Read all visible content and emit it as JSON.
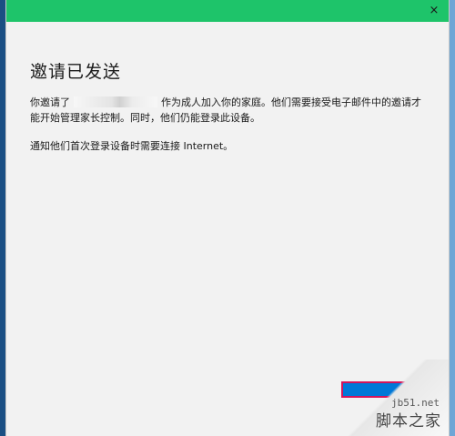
{
  "window": {
    "close_label": "×"
  },
  "dialog": {
    "heading": "邀请已发送",
    "paragraph1_before": "你邀请了",
    "paragraph1_after": "作为成人加入你的家庭。他们需要接受电子邮件中的邀请才能开始管理家长控制。同时，他们仍能登录此设备。",
    "paragraph2": "通知他们首次登录设备时需要连接 Internet。"
  },
  "watermark": {
    "url": "jb51.net",
    "name": "脚本之家"
  },
  "colors": {
    "titlebar": "#1ec46a",
    "dialog_bg": "#f2f2f2",
    "button_blue": "#0078d7",
    "highlight_red": "#d4145a"
  }
}
